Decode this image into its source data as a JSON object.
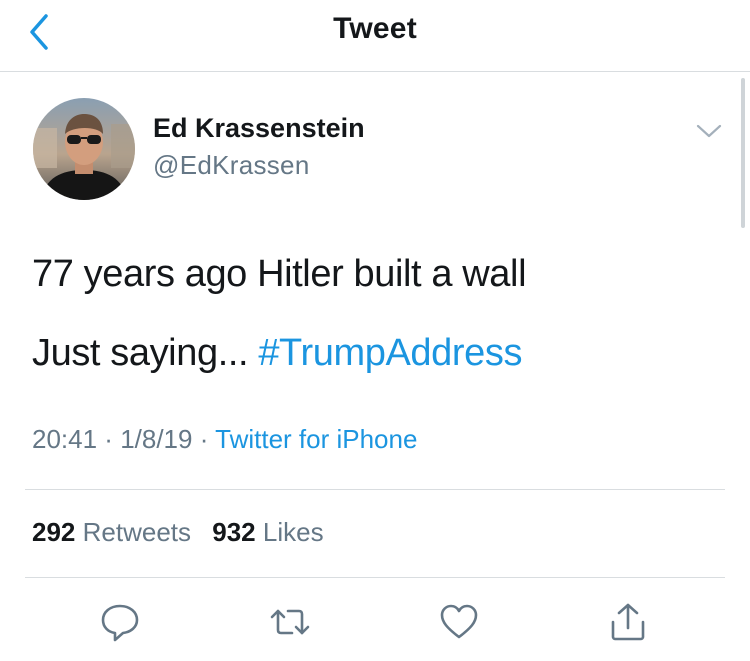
{
  "header": {
    "title": "Tweet",
    "back_icon": "chevron-left-icon"
  },
  "colors": {
    "accent": "#1b95e0",
    "text": "#14171a",
    "muted": "#657786",
    "divider": "#d9dde0"
  },
  "tweet": {
    "author": {
      "name": "Ed Krassenstein",
      "handle": "@EdKrassen"
    },
    "line1": "77 years ago Hitler built a wall",
    "line2_text": "Just saying... ",
    "hashtag": "#TrumpAddress",
    "time": "20:41",
    "separator": " · ",
    "date": "1/8/19",
    "source": "Twitter for iPhone"
  },
  "stats": {
    "retweets_count": "292",
    "retweets_label": "Retweets",
    "likes_count": "932",
    "likes_label": "Likes"
  },
  "actions": {
    "reply_icon": "reply-icon",
    "retweet_icon": "retweet-icon",
    "like_icon": "heart-icon",
    "share_icon": "share-icon"
  }
}
